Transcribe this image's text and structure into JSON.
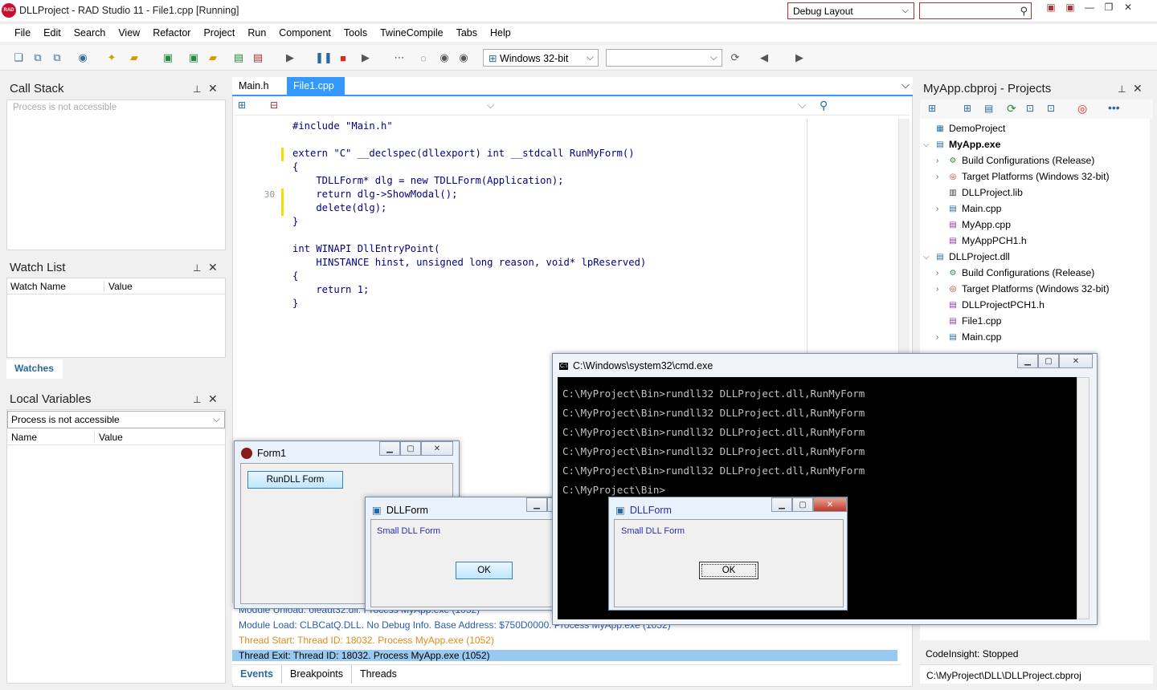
{
  "title": "DLLProject - RAD Studio 11 - File1.cpp [Running]",
  "layout": "Debug Layout",
  "menu": [
    "File",
    "Edit",
    "Search",
    "View",
    "Refactor",
    "Project",
    "Run",
    "Component",
    "Tools",
    "TwineCompile",
    "Tabs",
    "Help"
  ],
  "platform": "Windows 32-bit",
  "callstack": {
    "title": "Call Stack",
    "msg": "Process is not accessible"
  },
  "watch": {
    "title": "Watch List",
    "col1": "Watch Name",
    "col2": "Value",
    "tab": "Watches"
  },
  "locals": {
    "title": "Local Variables",
    "combo": "Process is not accessible",
    "col1": "Name",
    "col2": "Value"
  },
  "editor": {
    "tabs": [
      "Main.h",
      "File1.cpp"
    ],
    "lines": [
      {
        "n": "",
        "t": "#include \"Main.h\""
      },
      {
        "n": "",
        "t": ""
      },
      {
        "n": "",
        "t": "extern \"C\" __declspec(dllexport) int __stdcall RunMyForm()"
      },
      {
        "n": "",
        "t": "{"
      },
      {
        "n": "",
        "t": "    TDLLForm* dlg = new TDLLForm(Application);"
      },
      {
        "n": "30",
        "t": "    return dlg->ShowModal();"
      },
      {
        "n": "",
        "t": "    delete(dlg);"
      },
      {
        "n": "",
        "t": "}"
      },
      {
        "n": "",
        "t": ""
      },
      {
        "n": "",
        "t": "int WINAPI DllEntryPoint("
      },
      {
        "n": "",
        "t": "    HINSTANCE hinst, unsigned long reason, void* lpReserved)"
      },
      {
        "n": "",
        "t": "{"
      },
      {
        "n": "",
        "t": "    return 1;"
      },
      {
        "n": "",
        "t": "}"
      }
    ]
  },
  "messages": [
    {
      "t": "Module Unload: oleaut32.dll. Process MyApp.exe (1052)",
      "c": "#2a5db0"
    },
    {
      "t": "Module Load: CLBCatQ.DLL. No Debug Info. Base Address: $750D0000. Process MyApp.exe (1052)",
      "c": "#2a5db0"
    },
    {
      "t": "Thread Start: Thread ID: 18032. Process MyApp.exe (1052)",
      "c": "#e08a1e"
    },
    {
      "t": "Thread Exit: Thread ID: 18032. Process MyApp.exe (1052)",
      "c": "#000000"
    }
  ],
  "bottom_tabs": [
    "Events",
    "Breakpoints",
    "Threads"
  ],
  "projects": {
    "title": "MyApp.cbproj - Projects",
    "items": [
      {
        "label": "DemoProject",
        "lvl": 0,
        "chev": "",
        "icon": "group"
      },
      {
        "label": "MyApp.exe",
        "lvl": 0,
        "chev": "v",
        "icon": "exe",
        "bold": true
      },
      {
        "label": "Build Configurations (Release)",
        "lvl": 1,
        "chev": ">",
        "icon": "gear"
      },
      {
        "label": "Target Platforms (Windows 32-bit)",
        "lvl": 1,
        "chev": ">",
        "icon": "target"
      },
      {
        "label": "DLLProject.lib",
        "lvl": 1,
        "chev": "",
        "icon": "lib"
      },
      {
        "label": "Main.cpp",
        "lvl": 1,
        "chev": ">",
        "icon": "file"
      },
      {
        "label": "MyApp.cpp",
        "lvl": 1,
        "chev": "",
        "icon": "cpp"
      },
      {
        "label": "MyAppPCH1.h",
        "lvl": 1,
        "chev": "",
        "icon": "h"
      },
      {
        "label": "DLLProject.dll",
        "lvl": 0,
        "chev": "v",
        "icon": "exe"
      },
      {
        "label": "Build Configurations (Release)",
        "lvl": 1,
        "chev": ">",
        "icon": "gear"
      },
      {
        "label": "Target Platforms (Windows 32-bit)",
        "lvl": 1,
        "chev": ">",
        "icon": "target"
      },
      {
        "label": "DLLProjectPCH1.h",
        "lvl": 1,
        "chev": "",
        "icon": "h"
      },
      {
        "label": "File1.cpp",
        "lvl": 1,
        "chev": "",
        "icon": "cpp"
      },
      {
        "label": "Main.cpp",
        "lvl": 1,
        "chev": ">",
        "icon": "file"
      }
    ],
    "codeinsight": "CodeInsight: Stopped",
    "path": "C:\\MyProject\\DLL\\DLLProject.cbproj"
  },
  "form1": {
    "title": "Form1",
    "button": "RunDLL Form"
  },
  "dllform1": {
    "title": "DLLForm",
    "label": "Small DLL Form",
    "ok": "OK"
  },
  "dllform2": {
    "title": "DLLForm",
    "label": "Small DLL Form",
    "ok": "OK"
  },
  "cmd": {
    "title": "C:\\Windows\\system32\\cmd.exe",
    "lines": [
      "C:\\MyProject\\Bin>rundll32 DLLProject.dll,RunMyForm",
      "C:\\MyProject\\Bin>rundll32 DLLProject.dll,RunMyForm",
      "C:\\MyProject\\Bin>rundll32 DLLProject.dll,RunMyForm",
      "C:\\MyProject\\Bin>rundll32 DLLProject.dll,RunMyForm",
      "C:\\MyProject\\Bin>rundll32 DLLProject.dll,RunMyForm",
      "C:\\MyProject\\Bin>"
    ]
  }
}
